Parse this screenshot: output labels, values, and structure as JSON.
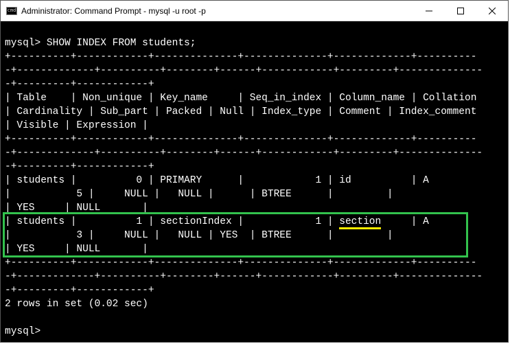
{
  "window": {
    "title": "Administrator: Command Prompt - mysql  -u root -p",
    "icon_label": "cmd"
  },
  "terminal": {
    "prompt": "mysql>",
    "command": "SHOW INDEX FROM students;",
    "result_footer": "2 rows in set (0.02 sec)",
    "header_cols_line1": "| Table    | Non_unique | Key_name     | Seq_in_index | Column_name | Collation",
    "header_cols_line2": "| Cardinality | Sub_part | Packed | Null | Index_type | Comment | Index_comment",
    "header_cols_line3": "| Visible | Expression |",
    "divider_full": "+----------+------------+--------------+--------------+-------------+----------",
    "divider_cont": "-+-------------+----------+--------+------+------------+---------+--------------",
    "divider_end": "-+---------+------------+",
    "row1": {
      "line1_a": "| students |          0 | PRIMARY      |            1 | id          | A",
      "line2_a": "|           5 |     NULL |   NULL |      | BTREE      |         |",
      "line3_a": "| YES     | NULL       |"
    },
    "row2": {
      "pre": "| students |          1 | sectionIndex |            1 | ",
      "highlighted": "section",
      "post": "     | A",
      "line2_a": "|           3 |     NULL |   NULL | YES  | BTREE      |         |",
      "line3_a": "| YES     | NULL       |"
    }
  }
}
